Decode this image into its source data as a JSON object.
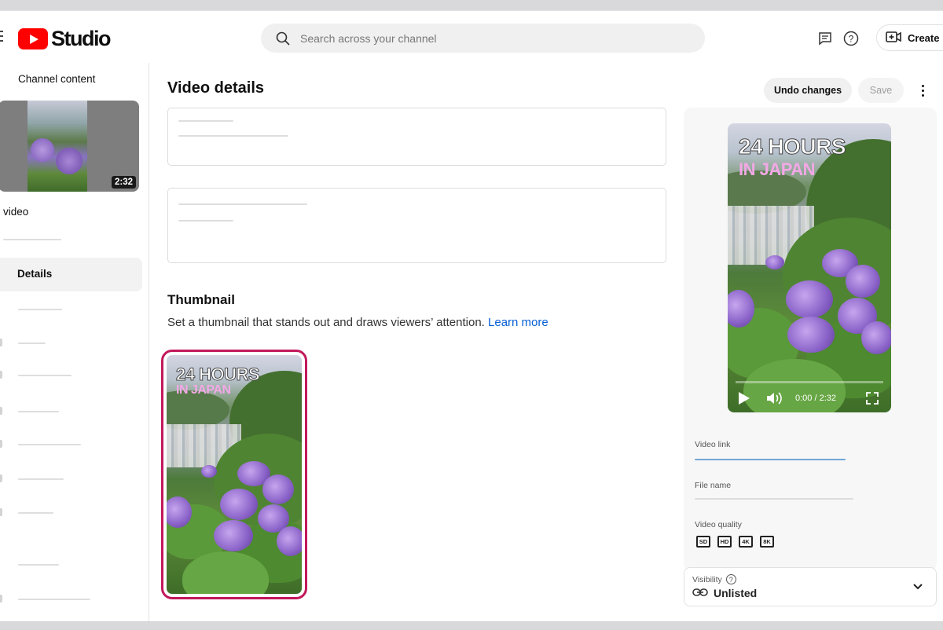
{
  "header": {
    "app_name": "Studio",
    "search_placeholder": "Search across your channel",
    "create_label": "Create"
  },
  "sidebar": {
    "section_title": "Channel content",
    "video_duration": "2:32",
    "video_title": "video",
    "active_item": "Details"
  },
  "main": {
    "title": "Video details",
    "undo_label": "Undo changes",
    "save_label": "Save",
    "thumbnail": {
      "heading": "Thumbnail",
      "description": "Set a thumbnail that stands out and draws viewers’ attention.",
      "learn_more": "Learn more",
      "overlay_line1": "24 HOURS",
      "overlay_line2": "IN JAPAN"
    }
  },
  "preview": {
    "overlay_line1": "24 HOURS",
    "overlay_line2": "IN JAPAN",
    "time": "0:00 / 2:32",
    "video_link_label": "Video link",
    "file_name_label": "File name",
    "video_quality_label": "Video quality",
    "quality_badges": [
      "SD",
      "HD",
      "4K",
      "8K"
    ]
  },
  "visibility": {
    "label": "Visibility",
    "value": "Unlisted"
  },
  "colors": {
    "youtube_red": "#ff0000",
    "selected_thumbnail_border": "#c2185b",
    "link_blue": "#065fd4",
    "video_link_underline": "#6fa8d8"
  },
  "icons": [
    "menu-icon",
    "search-icon",
    "feedback-icon",
    "help-icon",
    "create-video-icon",
    "more-vert-icon",
    "play-icon",
    "volume-icon",
    "fullscreen-icon",
    "help-circle-icon",
    "link-icon",
    "chevron-down-icon"
  ]
}
